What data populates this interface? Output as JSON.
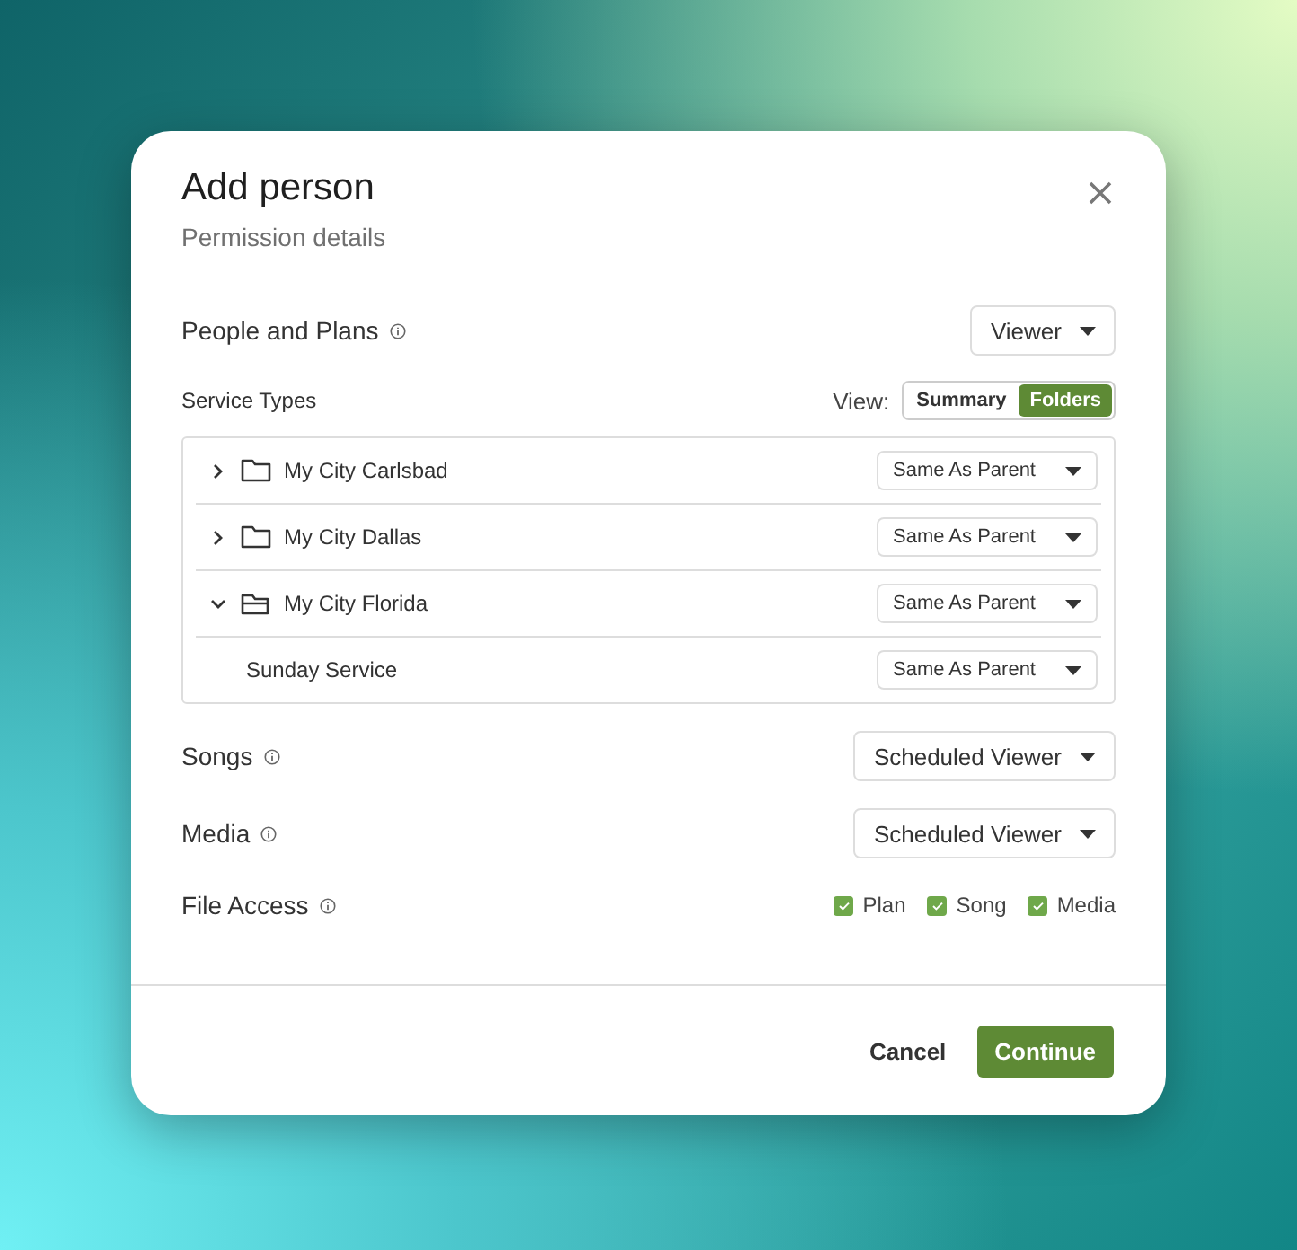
{
  "dialog": {
    "title": "Add person",
    "subtitle": "Permission details"
  },
  "people_and_plans": {
    "label": "People and Plans",
    "value": "Viewer"
  },
  "service_types": {
    "label": "Service Types",
    "view_label": "View:",
    "view_options": [
      {
        "label": "Summary",
        "selected": false
      },
      {
        "label": "Folders",
        "selected": true
      }
    ],
    "items": [
      {
        "name": "My City Carlsbad",
        "expanded": false,
        "value": "Same As Parent"
      },
      {
        "name": "My City Dallas",
        "expanded": false,
        "value": "Same As Parent"
      },
      {
        "name": "My City Florida",
        "expanded": true,
        "value": "Same As Parent",
        "children": [
          {
            "name": "Sunday Service",
            "value": "Same As Parent"
          }
        ]
      }
    ]
  },
  "permissions": [
    {
      "label": "Songs",
      "value": "Scheduled Viewer"
    },
    {
      "label": "Media",
      "value": "Scheduled Viewer"
    }
  ],
  "file_access": {
    "label": "File Access",
    "options": [
      {
        "label": "Plan",
        "checked": true
      },
      {
        "label": "Song",
        "checked": true
      },
      {
        "label": "Media",
        "checked": true
      }
    ]
  },
  "buttons": {
    "cancel": "Cancel",
    "confirm": "Continue"
  }
}
